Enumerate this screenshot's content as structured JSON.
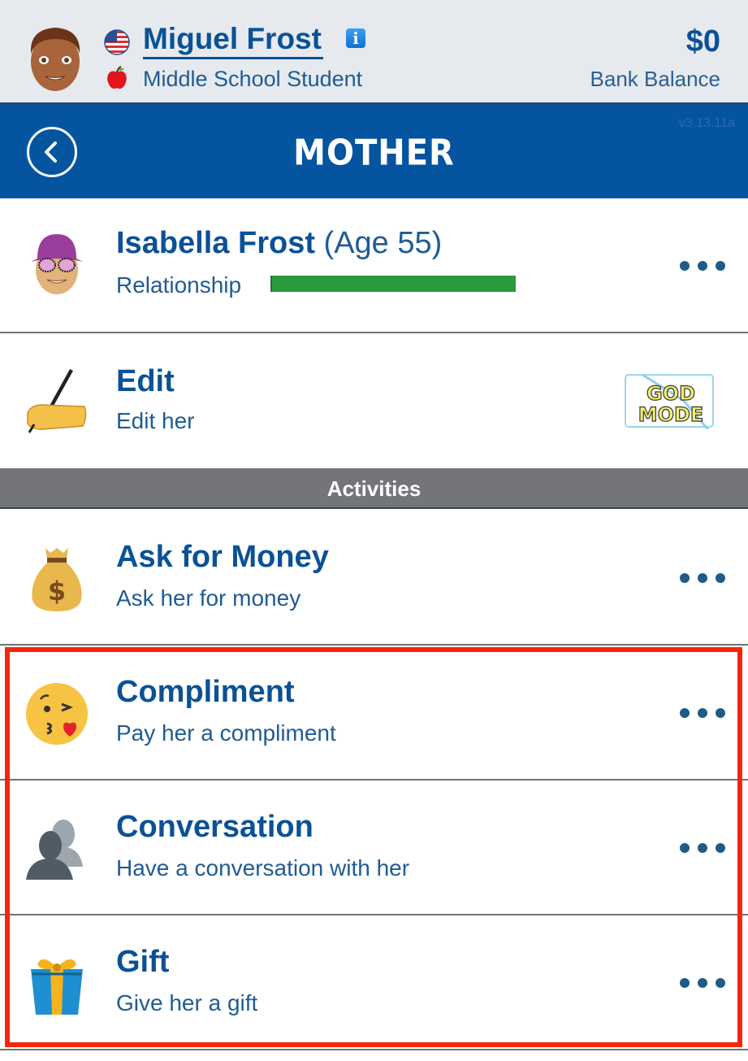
{
  "header": {
    "player_name": "Miguel Frost",
    "occupation": "Middle School Student",
    "bank_amount": "$0",
    "bank_label": "Bank Balance",
    "icons": {
      "avatar": "male-face-avatar",
      "flag": "us-flag-icon",
      "occupation": "apple-icon",
      "info": "info-icon"
    }
  },
  "navbar": {
    "title": "MOTHER",
    "version": "v3.13.11a",
    "back_icon": "chevron-left-circle-icon"
  },
  "person": {
    "name": "Isabella Frost",
    "age_label": "(Age 55)",
    "relationship_label": "Relationship",
    "relationship_value_percent": 100,
    "relationship_color": "#2a9a3e",
    "icon": "female-face-avatar-purple-hat"
  },
  "edit_row": {
    "title": "Edit",
    "subtitle": "Edit her",
    "icon": "writing-hand-icon",
    "badge_line1": "GOD",
    "badge_line2": "MODE"
  },
  "section": {
    "title": "Activities"
  },
  "activities": [
    {
      "title": "Ask for Money",
      "subtitle": "Ask her for money",
      "icon": "money-bag-icon"
    },
    {
      "title": "Compliment",
      "subtitle": "Pay her a compliment",
      "icon": "kissing-face-icon"
    },
    {
      "title": "Conversation",
      "subtitle": "Have a conversation with her",
      "icon": "busts-icon"
    },
    {
      "title": "Gift",
      "subtitle": "Give her a gift",
      "icon": "gift-icon"
    }
  ],
  "colors": {
    "brand_blue": "#0454a0",
    "text_blue": "#0b5196",
    "highlight_red": "#f5260e",
    "section_gray": "#737579"
  }
}
